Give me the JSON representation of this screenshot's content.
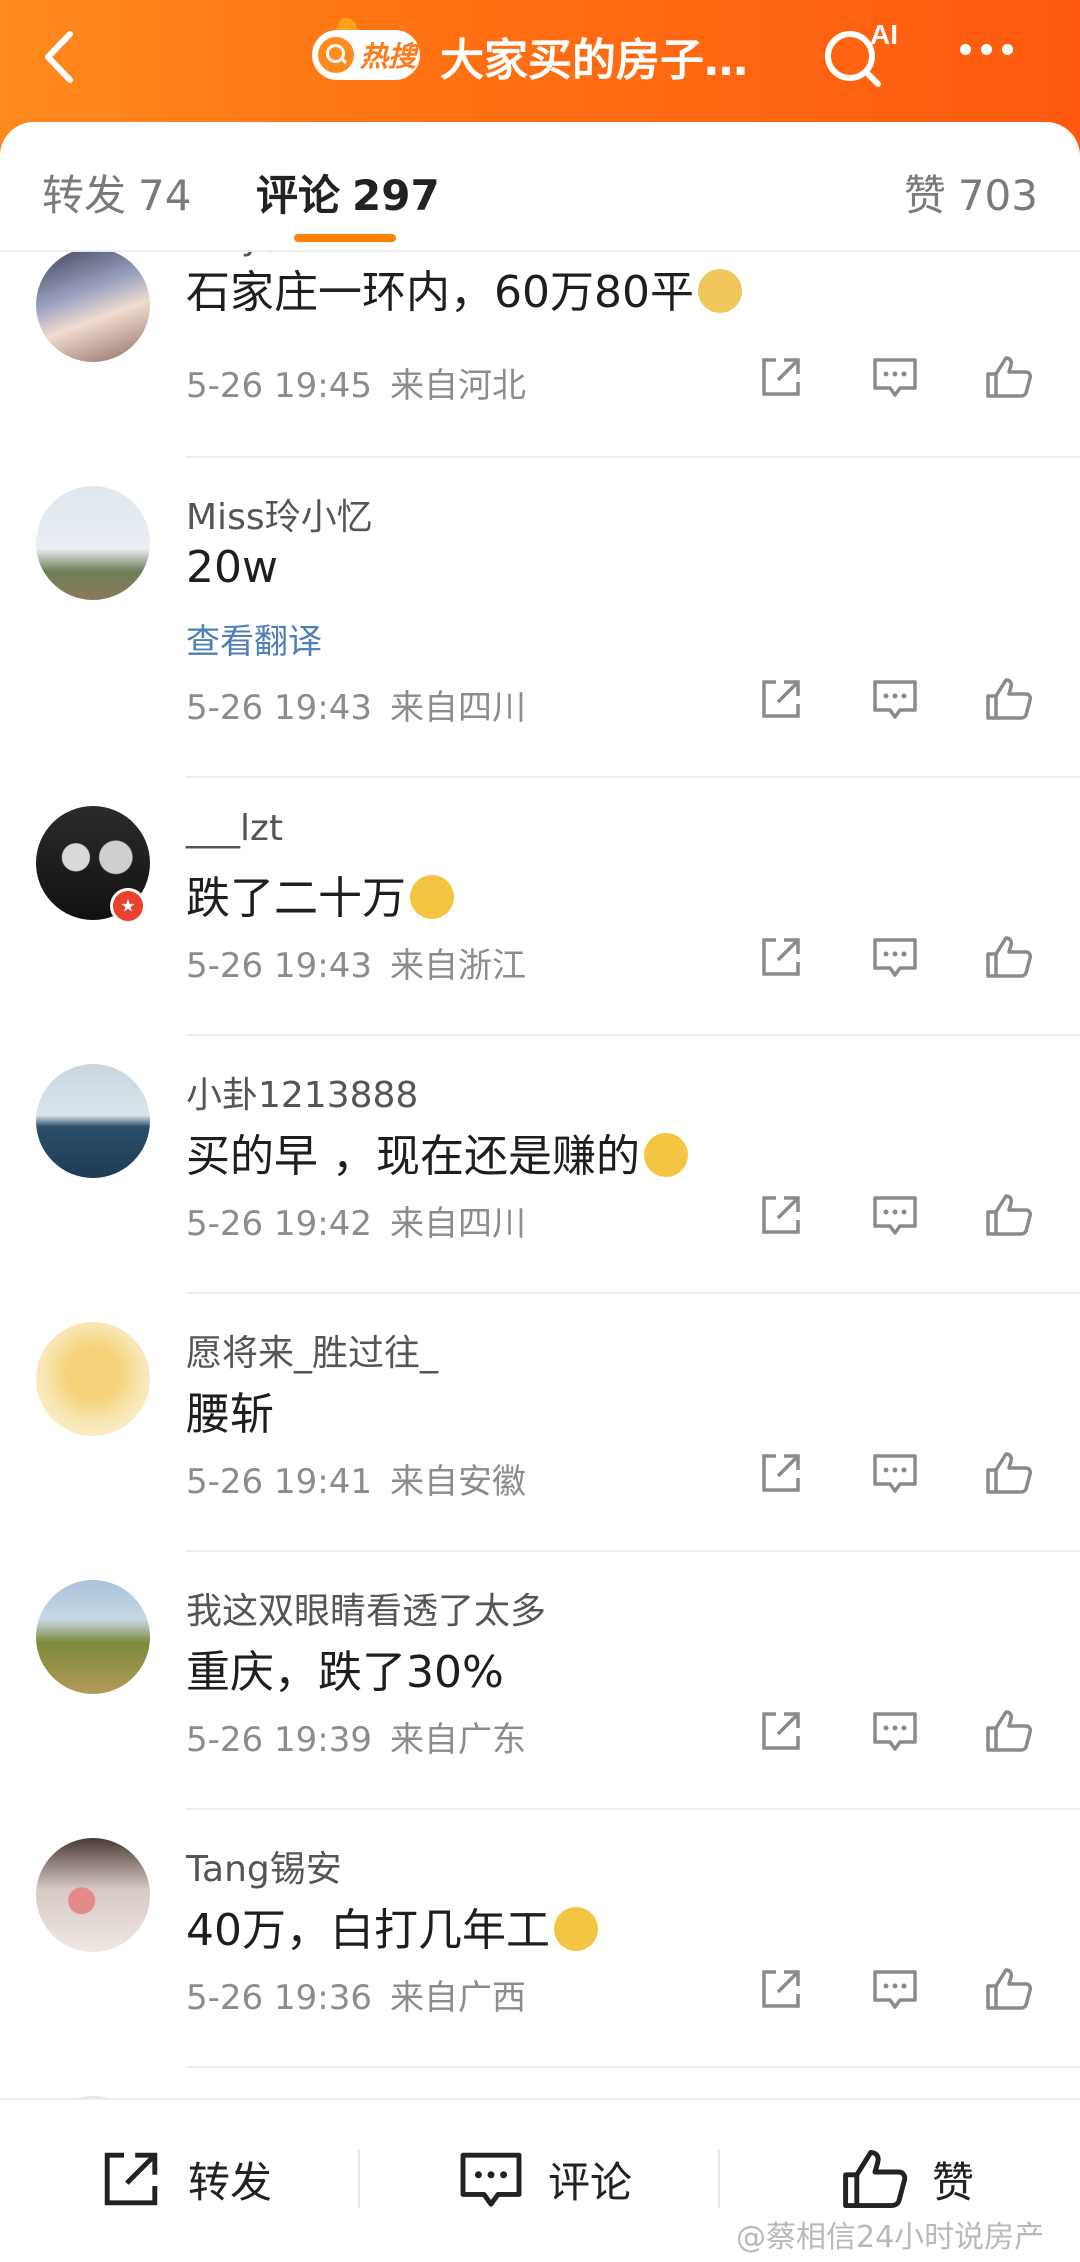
{
  "header": {
    "hot_label": "热搜",
    "title": "大家买的房子…",
    "ai_label": "AI"
  },
  "tabs": [
    {
      "label": "转发",
      "count": "74"
    },
    {
      "label": "评论",
      "count": "297"
    },
    {
      "label": "赞",
      "count": "703"
    }
  ],
  "comments": [
    {
      "username": "lady肖莲",
      "content": "石家庄一环内，60万80平",
      "emoji": "doge",
      "time": "5-26 19:45",
      "location": "来自河北"
    },
    {
      "username": "Miss玲小忆",
      "content": "20w",
      "translate": "查看翻译",
      "time": "5-26 19:43",
      "location": "来自四川"
    },
    {
      "username": "___lzt",
      "content": "跌了二十万",
      "emoji": "sad",
      "time": "5-26 19:43",
      "location": "来自浙江"
    },
    {
      "username": "小卦1213888",
      "content": "买的早 ，现在还是赚的",
      "emoji": "laugh-cry",
      "time": "5-26 19:42",
      "location": "来自四川"
    },
    {
      "username": "愿将来_胜过往_",
      "content": "腰斩",
      "time": "5-26 19:41",
      "location": "来自安徽"
    },
    {
      "username": "我这双眼睛看透了太多",
      "content": "重庆，跌了30%",
      "time": "5-26 19:39",
      "location": "来自广东"
    },
    {
      "username": "Tang锡安",
      "content": "40万，白打几年工",
      "emoji": "crying",
      "time": "5-26 19:36",
      "location": "来自广西"
    }
  ],
  "bottom_bar": {
    "repost_label": "转发",
    "comment_label": "评论",
    "like_label": "赞"
  },
  "watermark": "@蔡相信24小时说房产",
  "colors": {
    "header_start": "#ff8a1e",
    "header_end": "#ff5a10",
    "tab_underline": "#ff8200",
    "link_blue": "#4e7fb5"
  }
}
